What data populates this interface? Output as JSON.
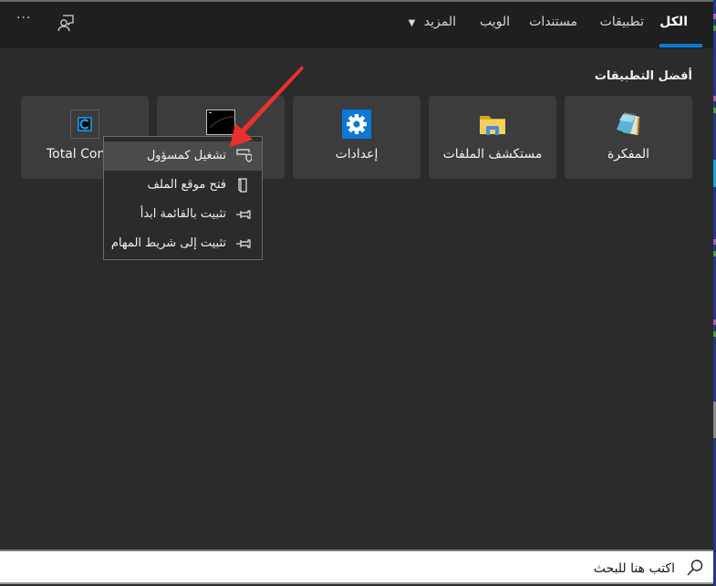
{
  "header": {
    "tabs": [
      {
        "label": "الكل",
        "active": true
      },
      {
        "label": "تطبيقات",
        "active": false
      },
      {
        "label": "مستندات",
        "active": false
      },
      {
        "label": "الويب",
        "active": false
      },
      {
        "label": "المزيد",
        "active": false,
        "has_dropdown": true
      }
    ],
    "feedback_icon": "feedback-person-icon",
    "more_options_icon": "ellipsis-icon",
    "more_options_label": "···"
  },
  "main": {
    "section_title": "أفضل التطبيقات",
    "apps": [
      {
        "label": "المفكرة",
        "icon": "notepad-icon"
      },
      {
        "label": "مستكشف الملفات",
        "icon": "file-explorer-icon"
      },
      {
        "label": "إعدادات",
        "icon": "settings-gear-icon"
      },
      {
        "label": "",
        "icon": "command-prompt-icon"
      },
      {
        "label": "Total Con",
        "icon": "total-commander-icon"
      }
    ]
  },
  "context_menu": {
    "items": [
      {
        "label": "تشغيل كمسؤول",
        "icon": "run-as-admin-shield-icon",
        "highlighted": true
      },
      {
        "label": "فتح موقع الملف",
        "icon": "open-file-location-icon",
        "highlighted": false
      },
      {
        "label": "تثبيت بالقائمة ابدأ",
        "icon": "pin-icon",
        "highlighted": false
      },
      {
        "label": "تثبيت إلى شريط المهام",
        "icon": "pin-icon",
        "highlighted": false
      }
    ]
  },
  "annotation": {
    "type": "arrow",
    "color": "#e8312f",
    "points_to": "تشغيل كمسؤول"
  },
  "search": {
    "placeholder": "اكتب هنا للبحث",
    "value": "",
    "icon": "search-icon"
  },
  "colors": {
    "accent": "#0a78d7",
    "header_bg": "#1f1f1f",
    "panel_bg": "#2b2b2b",
    "tile_bg": "#3c3c3c",
    "menu_highlight": "#4b4b4b"
  }
}
